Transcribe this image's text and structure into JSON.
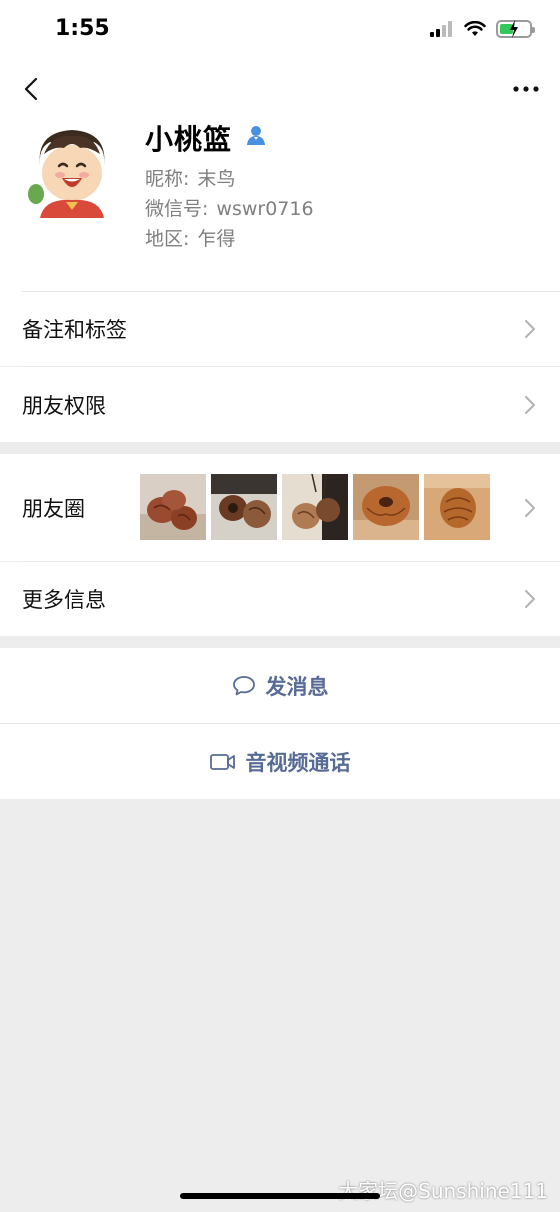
{
  "status_bar": {
    "time": "1:55",
    "icons": [
      "cellular-signal-icon",
      "wifi-icon",
      "battery-charging-icon"
    ]
  },
  "nav": {
    "back_icon": "chevron-left-icon",
    "more_icon": "more-dots-icon"
  },
  "profile": {
    "name": "小桃篮",
    "badge_icon": "verified-person-icon",
    "nickname_label": "昵称:",
    "nickname_value": "末鸟",
    "wechat_id_label": "微信号:",
    "wechat_id_value": "wswr0716",
    "region_label": "地区:",
    "region_value": "乍得"
  },
  "menu": {
    "remarks_tags": "备注和标签",
    "friend_permissions": "朋友权限",
    "moments": "朋友圈",
    "more_info": "更多信息"
  },
  "actions": {
    "send_message": "发消息",
    "video_call": "音视频通话"
  },
  "watermark": "大家坛@Sunshine111",
  "colors": {
    "link": "#576b95",
    "background": "#ededed",
    "battery": "#34c759",
    "verify": "#4a90e2"
  }
}
